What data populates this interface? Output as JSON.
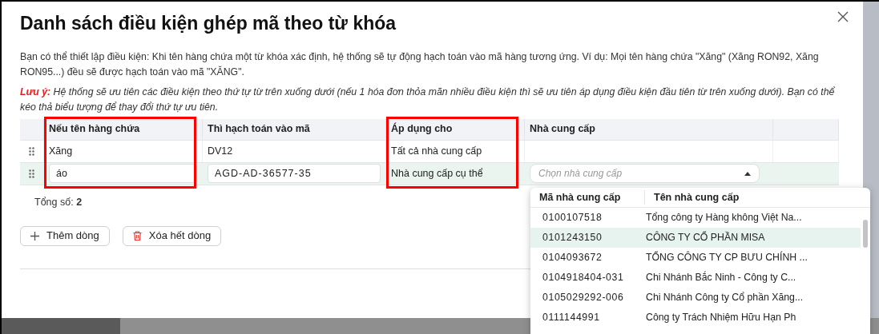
{
  "dialog": {
    "title": "Danh sách điều kiện ghép mã theo từ khóa",
    "description": "Bạn có thể thiết lập điều kiện: Khi tên hàng chứa một từ khóa xác định, hệ thống sẽ tự động hạch toán vào mã hàng tương ứng. Ví dụ: Mọi tên hàng chứa \"Xăng\" (Xăng RON92, Xăng RON95...) đều sẽ được hạch toán vào mã \"XĂNG\".",
    "note_label": "Lưu ý:",
    "note": "Hệ thống sẽ ưu tiên các điều kiện theo thứ tự từ trên xuống dưới (nếu 1 hóa đơn thỏa mãn nhiều điều kiện thì sẽ ưu tiên áp dụng điều kiện đầu tiên từ trên xuống dưới). Bạn có thể kéo thả biểu tượng để thay đổi thứ tự ưu tiên."
  },
  "table": {
    "columns": [
      {
        "label": "Nếu tên hàng chứa",
        "highlighted": true
      },
      {
        "label": "Thì hạch toán vào mã"
      },
      {
        "label": "Áp dụng cho",
        "highlighted": true
      },
      {
        "label": "Nhà cung cấp"
      }
    ],
    "rows": [
      {
        "selected": false,
        "cells": [
          {
            "kind": "text",
            "value": "Xăng"
          },
          {
            "kind": "text",
            "value": "DV12"
          },
          {
            "kind": "text",
            "value": "Tất cả nhà cung cấp"
          },
          {
            "kind": "text"
          }
        ]
      },
      {
        "selected": true,
        "cells": [
          {
            "kind": "input",
            "value": "áo"
          },
          {
            "kind": "input",
            "value": "AGD-AD-36577-35"
          },
          {
            "kind": "text",
            "value": "Nhà cung cấp cụ thể"
          },
          {
            "kind": "select",
            "placeholder": "Chọn nhà cung cấp",
            "expanded": true
          }
        ]
      }
    ],
    "total_label": "Tổng số:",
    "total": "2"
  },
  "buttons": [
    {
      "kind": "add",
      "label": "Thêm dòng"
    },
    {
      "kind": "delete",
      "label": "Xóa hết dòng"
    }
  ],
  "supplier_dropdown": {
    "columns": [
      "Mã nhà cung cấp",
      "Tên nhà cung cấp"
    ],
    "items": [
      {
        "code": "0100107518",
        "name": "Tổng công ty Hàng không Việt Na...",
        "selected": false
      },
      {
        "code": "0101243150",
        "name": "CÔNG TY CỔ PHẦN MISA",
        "selected": true
      },
      {
        "code": "0104093672",
        "name": "TỔNG CÔNG TY CP BƯU CHÍNH ...",
        "selected": false
      },
      {
        "code": "0104918404-031",
        "name": "Chi Nhánh Bắc Ninh - Công ty C...",
        "selected": false
      },
      {
        "code": "0105029292-006",
        "name": "Chi Nhánh Công ty Cổ phần Xăng...",
        "selected": false
      },
      {
        "code": "0111144991",
        "name": "Công ty Trách Nhiệm Hữu Hạn Ph",
        "selected": false
      }
    ]
  }
}
